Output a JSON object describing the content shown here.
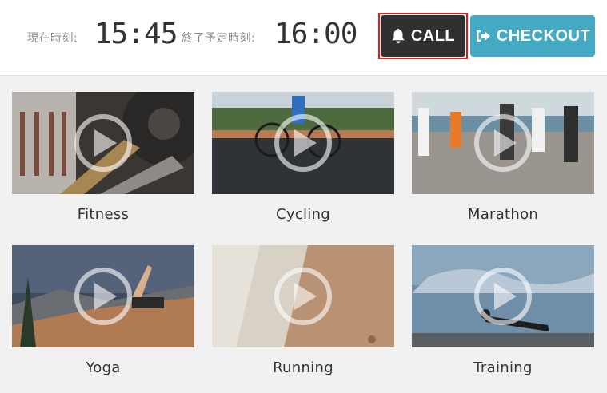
{
  "header": {
    "current_time_label": "現在時刻:",
    "current_time": "15:45",
    "end_time_label": "終了予定時刻:",
    "end_time": "16:00",
    "call_button": {
      "label": "CALL",
      "icon": "bell-icon"
    },
    "checkout_button": {
      "label": "CHECKOUT",
      "icon": "sign-out-icon"
    }
  },
  "videos": [
    {
      "title": "Fitness",
      "icon": "play-icon"
    },
    {
      "title": "Cycling",
      "icon": "play-icon"
    },
    {
      "title": "Marathon",
      "icon": "play-icon"
    },
    {
      "title": "Yoga",
      "icon": "play-icon"
    },
    {
      "title": "Running",
      "icon": "play-icon"
    },
    {
      "title": "Training",
      "icon": "play-icon"
    }
  ],
  "colors": {
    "call_bg": "#303030",
    "checkout_bg": "#44aac3",
    "highlight": "#e01b1b",
    "page_bg": "#f1f1f1"
  }
}
